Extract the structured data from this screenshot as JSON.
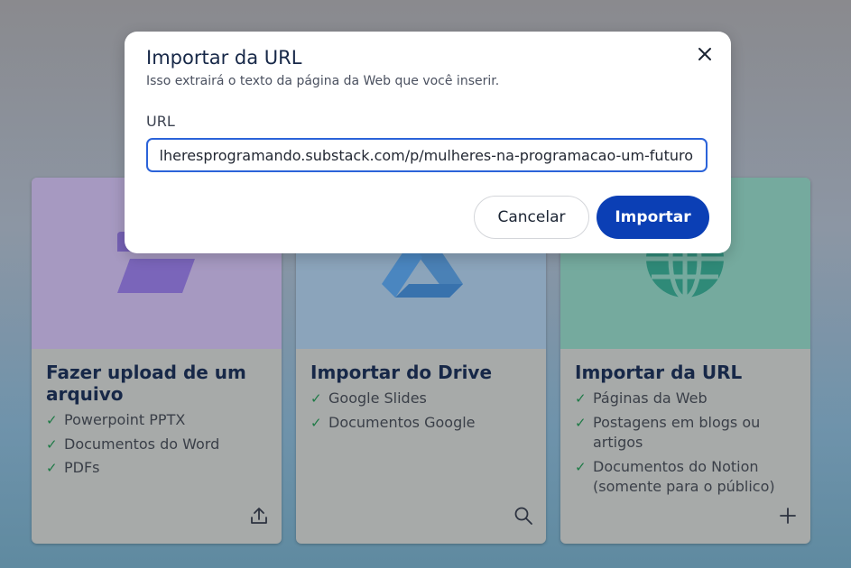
{
  "cards": [
    {
      "title": "Fazer upload de um arquivo",
      "items": [
        "Powerpoint PPTX",
        "Documentos do Word",
        "PDFs"
      ],
      "icon": "upload-icon",
      "hero_icon": "folder-icon",
      "hero_color": "#a699c1"
    },
    {
      "title": "Importar do Drive",
      "items": [
        "Google Slides",
        "Documentos Google"
      ],
      "icon": "search-icon",
      "hero_icon": "drive-icon",
      "hero_color": "#8ba4bb"
    },
    {
      "title": "Importar da URL",
      "items": [
        "Páginas da Web",
        "Postagens em blogs ou artigos",
        "Documentos do Notion (somente para o público)"
      ],
      "icon": "plus-icon",
      "hero_icon": "globe-icon",
      "hero_color": "#75aa9e"
    }
  ],
  "modal": {
    "title": "Importar da URL",
    "subtitle": "Isso extrairá o texto da página da Web que você inserir.",
    "field_label": "URL",
    "url_value": "https://mulheresprogramando.substack.com/p/mulheres-na-programacao-um-futuro",
    "cancel_label": "Cancelar",
    "import_label": "Importar",
    "close_icon": "close-icon"
  },
  "colors": {
    "accent": "#0b3fb5",
    "check": "#1e7a46",
    "title_text": "#172848"
  }
}
